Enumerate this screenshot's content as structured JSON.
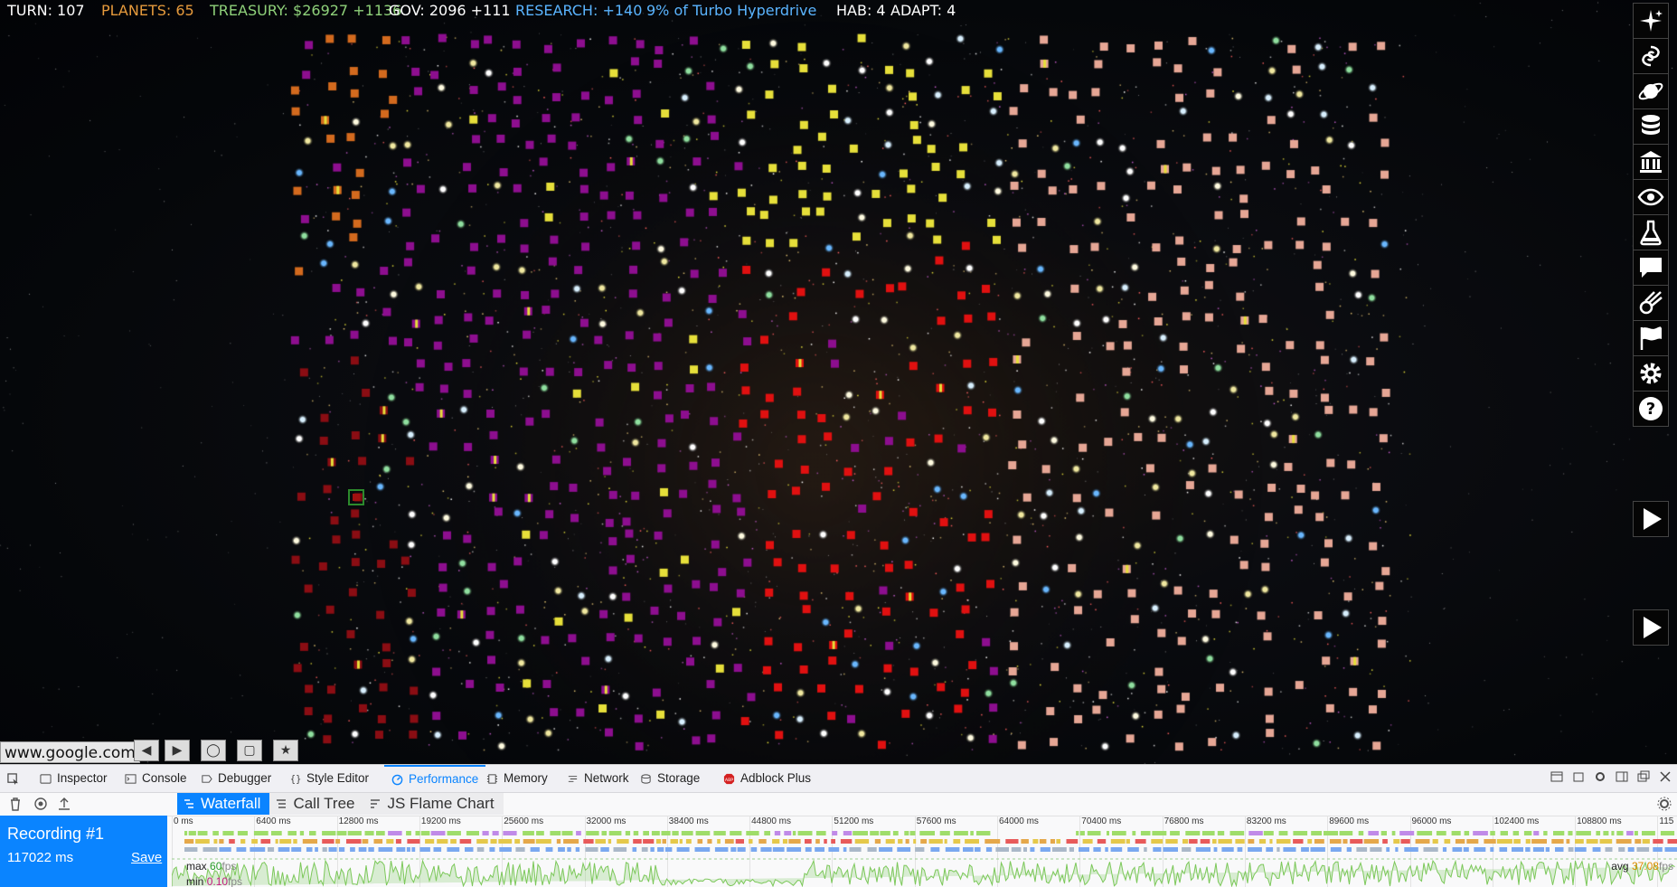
{
  "hud": {
    "turn": "TURN: 107",
    "planets": "PLANETS: 65",
    "treasury": "TREASURY: $26927 +1136",
    "gov": "GOV: 2096 +111",
    "research": "RESEARCH: +140",
    "project": "9% of Turbo Hyperdrive",
    "hab": "HAB: 4",
    "adapt": "ADAPT: 4",
    "colors": {
      "turn": "#ffffff",
      "planets": "#e69a3c",
      "treasury": "#8fd17a",
      "gov": "#ffffff",
      "research": "#5ab4ff",
      "project": "#5ab4ff",
      "hab": "#ffffff",
      "adapt": "#ffffff"
    }
  },
  "right_menu": [
    {
      "name": "stars-icon"
    },
    {
      "name": "galaxy-icon"
    },
    {
      "name": "planet-icon"
    },
    {
      "name": "database-icon"
    },
    {
      "name": "government-icon"
    },
    {
      "name": "eye-icon"
    },
    {
      "name": "flask-icon"
    },
    {
      "name": "chat-icon"
    },
    {
      "name": "comet-icon"
    },
    {
      "name": "flag-icon"
    },
    {
      "name": "gear-icon"
    },
    {
      "name": "help-icon"
    },
    {
      "name": "play-icon"
    },
    {
      "name": "end-turn-play-icon"
    }
  ],
  "url": "www.google.com",
  "map_controls": [
    {
      "name": "left-arrow-icon",
      "glyph": "◀"
    },
    {
      "name": "right-arrow-icon",
      "glyph": "▶"
    },
    {
      "name": "circle-icon",
      "glyph": "◯"
    },
    {
      "name": "square-icon",
      "glyph": "▢"
    },
    {
      "name": "star-icon",
      "glyph": "★"
    }
  ],
  "empire_colors": {
    "orange": "#d36a1e",
    "purple": "#8d0e8f",
    "yellow": "#e6df3a",
    "red": "#e01010",
    "darkred": "#8a0d13",
    "pink": "#e6a695"
  },
  "devtools": {
    "tabs": [
      {
        "label": "Inspector",
        "icon": "inspector-icon"
      },
      {
        "label": "Console",
        "icon": "console-icon"
      },
      {
        "label": "Debugger",
        "icon": "debugger-icon"
      },
      {
        "label": "Style Editor",
        "icon": "style-editor-icon"
      },
      {
        "label": "Performance",
        "icon": "performance-icon"
      },
      {
        "label": "Memory",
        "icon": "memory-icon"
      },
      {
        "label": "Network",
        "icon": "network-icon"
      },
      {
        "label": "Storage",
        "icon": "storage-icon"
      },
      {
        "label": "Adblock Plus",
        "icon": "adblock-icon"
      }
    ],
    "active_tab": "Performance",
    "subtabs": [
      {
        "label": "Waterfall",
        "active": true
      },
      {
        "label": "Call Tree",
        "active": false
      },
      {
        "label": "JS Flame Chart",
        "active": false
      }
    ],
    "recording": {
      "title": "Recording #1",
      "duration": "117022 ms",
      "save": "Save"
    },
    "ticks": [
      "0 ms",
      "6400 ms",
      "12800 ms",
      "19200 ms",
      "25600 ms",
      "32000 ms",
      "38400 ms",
      "44800 ms",
      "51200 ms",
      "57600 ms",
      "64000 ms",
      "70400 ms",
      "76800 ms",
      "83200 ms",
      "89600 ms",
      "96000 ms",
      "102400 ms",
      "108800 ms",
      "115"
    ],
    "fps": {
      "max_label": "max",
      "max_value": "60",
      "min_label": "min",
      "min_value": "0.10",
      "avg_label": "avg",
      "avg_value": "37.08",
      "unit": "fps"
    }
  }
}
